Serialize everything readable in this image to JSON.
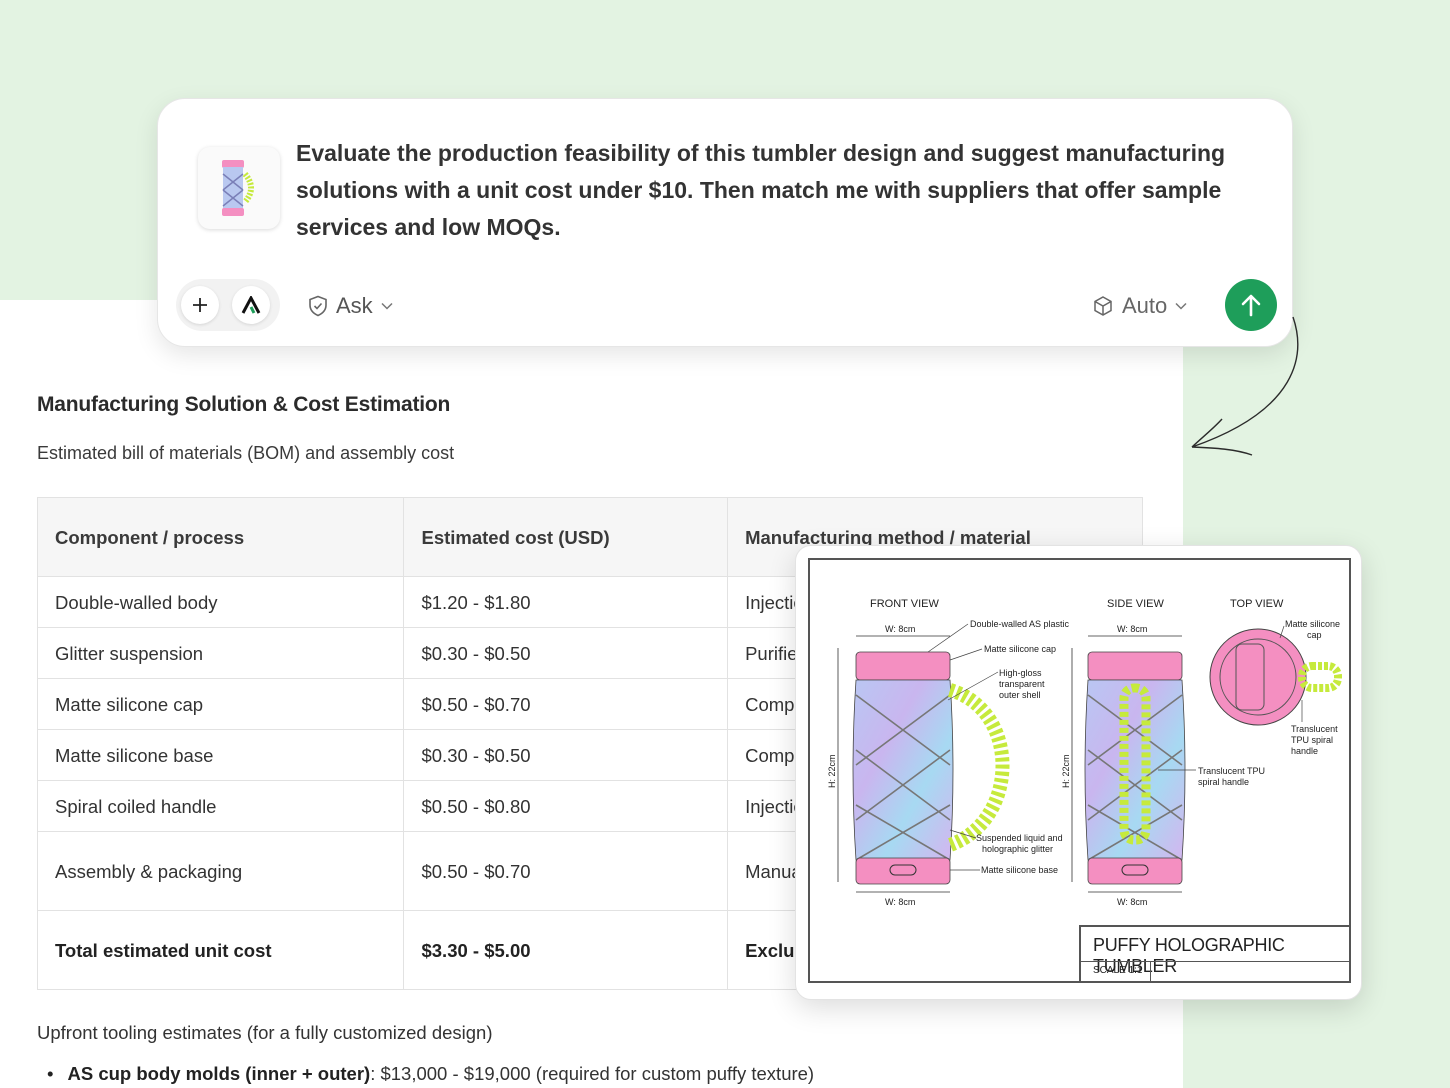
{
  "prompt": {
    "text": "Evaluate the production feasibility of this tumbler design and suggest manufacturing solutions with a unit cost under $10. Then match me with suppliers that offer sample services and low MOQs.",
    "ask_label": "Ask",
    "auto_label": "Auto"
  },
  "section": {
    "title": "Manufacturing Solution & Cost Estimation",
    "subtitle": "Estimated bill of materials (BOM) and assembly cost"
  },
  "table": {
    "headers": [
      "Component / process",
      "Estimated cost (USD)",
      "Manufacturing method / material"
    ],
    "rows": [
      [
        "Double-walled body",
        "$1.20 - $1.80",
        "Injection molded AS plastic"
      ],
      [
        "Glitter suspension",
        "$0.30 - $0.50",
        "Purified water, glycerin, hol"
      ],
      [
        "Matte silicone cap",
        "$0.50 - $0.70",
        "Compression molded food-"
      ],
      [
        "Matte silicone base",
        "$0.30 - $0.50",
        "Compression molded food-"
      ],
      [
        "Spiral coiled handle",
        "$0.50 - $0.80",
        "Injection molded translucer"
      ],
      [
        "Assembly & packaging",
        "$0.50 - $0.70",
        "Manual assembly, quality c box"
      ]
    ],
    "total": [
      "Total estimated unit cost",
      "$3.30 - $5.00",
      "Excluding upfront tooling"
    ]
  },
  "tooling": {
    "intro": "Upfront tooling estimates (for a fully customized design)",
    "items": [
      {
        "label": "AS cup body molds (inner + outer)",
        "value": ": $13,000 - $19,000 (required for custom puffy texture)"
      }
    ]
  },
  "drawing": {
    "front_view": "FRONT VIEW",
    "side_view": "SIDE VIEW",
    "top_view": "TOP VIEW",
    "width_label": "W: 8cm",
    "height_label": "H: 22cm",
    "callouts": {
      "body": "Double-walled AS plastic",
      "cap": "Matte silicone cap",
      "shell_1": "High-gloss",
      "shell_2": "transparent",
      "shell_3": "outer shell",
      "liquid_1": "Suspended liquid and",
      "liquid_2": "holographic glitter",
      "base": "Matte silicone base",
      "handle_1": "Translucent TPU",
      "handle_2": "spiral handle",
      "top_cap_1": "Matte silicone",
      "top_cap_2": "cap",
      "top_handle_1": "Translucent",
      "top_handle_2": "TPU spiral",
      "top_handle_3": "handle"
    },
    "title": "PUFFY HOLOGRAPHIC TUMBLER",
    "scale": "SCALE 1:1"
  },
  "colors": {
    "accent_green": "#1e9e5a",
    "background_green": "#e3f3e2",
    "tumbler_pink": "#f48fc1",
    "handle_lime": "#c6ea3c"
  }
}
